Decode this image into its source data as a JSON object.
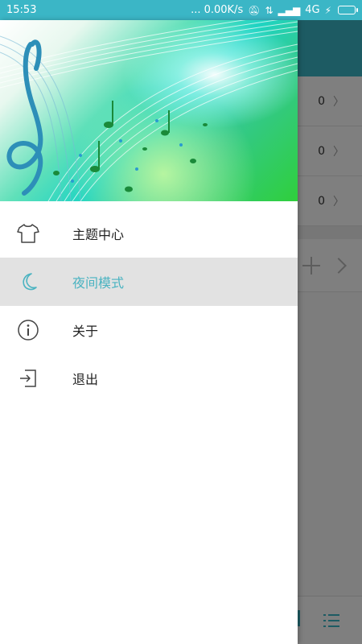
{
  "status_bar": {
    "time": "15:53",
    "net_speed": "... 0.00K/s",
    "network": "4G",
    "accent": "#3bb6c6"
  },
  "background_app": {
    "rows": [
      {
        "count": "0"
      },
      {
        "count": "0"
      },
      {
        "count": "0"
      }
    ],
    "action_row_icons": [
      "plus-icon",
      "chevron-right-icon"
    ],
    "bottom_bar_icon": "playlist-icon"
  },
  "drawer": {
    "header_image": "music-notes-banner",
    "menu": [
      {
        "label": "主题中心",
        "icon": "tshirt-icon",
        "active": false
      },
      {
        "label": "夜间模式",
        "icon": "moon-icon",
        "active": true
      },
      {
        "label": "关于",
        "icon": "info-icon",
        "active": false
      },
      {
        "label": "退出",
        "icon": "exit-icon",
        "active": false
      }
    ],
    "active_color": "#4ab3c1"
  }
}
